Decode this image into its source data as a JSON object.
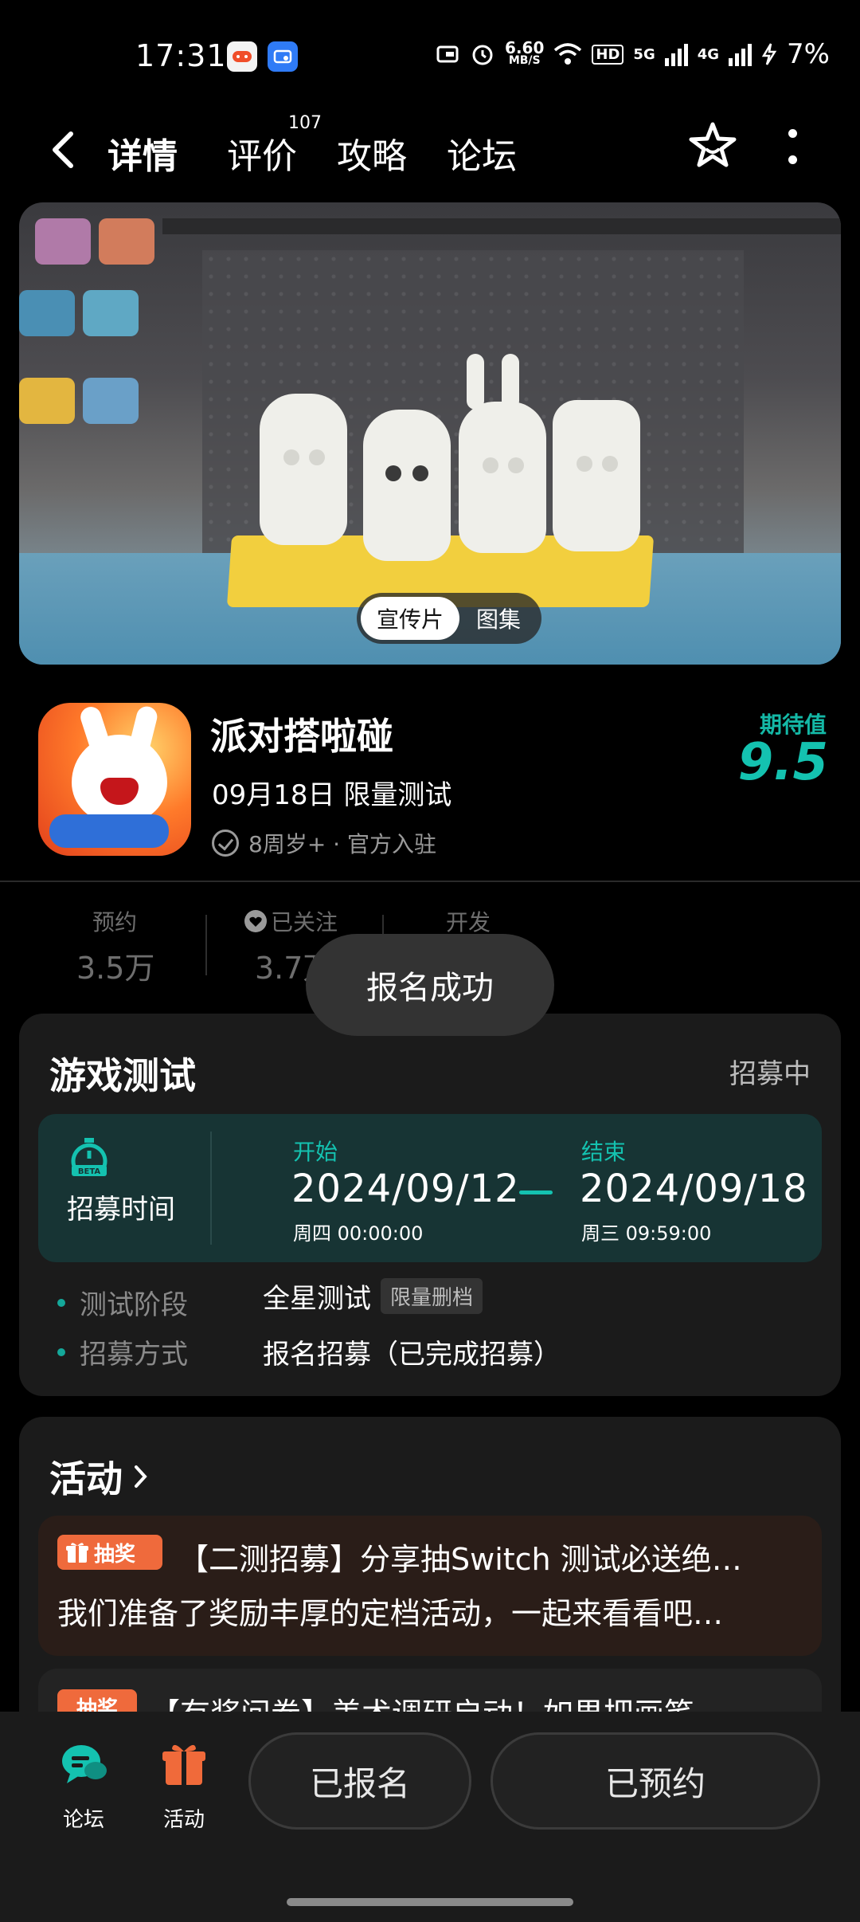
{
  "status_bar": {
    "time": "17:31",
    "net_speed": "6.60",
    "net_unit": "MB/S",
    "hd_tag": "HD",
    "sig1": "5G",
    "sig2": "4G",
    "battery": "7%"
  },
  "header": {
    "tabs": [
      {
        "label": "详情",
        "active": true
      },
      {
        "label": "评价",
        "badge": "107"
      },
      {
        "label": "攻略"
      },
      {
        "label": "论坛"
      }
    ]
  },
  "banner": {
    "toggle": {
      "active": "宣传片",
      "inactive": "图集"
    }
  },
  "game": {
    "title": "派对搭啦碰",
    "date_info": "09月18日 限量测试",
    "meta": "8周岁+ · 官方入驻",
    "expect_label": "期待值",
    "expect_value": "9.5"
  },
  "stats": [
    {
      "label": "预约",
      "value": "3.5万"
    },
    {
      "label": "已关注",
      "value": "3.7万"
    },
    {
      "label": "开发",
      "value": ""
    }
  ],
  "toast": "报名成功",
  "test_card": {
    "title": "游戏测试",
    "status": "招募中",
    "recruit_label": "招募时间",
    "start_label": "开始",
    "start_date": "2024/09/12",
    "start_sub": "周四  00:00:00",
    "end_label": "结束",
    "end_date": "2024/09/18",
    "end_sub": "周三  09:59:00",
    "rows": [
      {
        "label": "测试阶段",
        "value": "全星测试",
        "tag": "限量删档"
      },
      {
        "label": "招募方式",
        "value": "报名招募（已完成招募）"
      }
    ]
  },
  "activities": {
    "title": "活动",
    "items": [
      {
        "tag": "抽奖",
        "title": "【二测招募】分享抽Switch 测试必送绝…",
        "desc": "我们准备了奖励丰厚的定档活动，一起来看看吧…"
      },
      {
        "tag": "抽奖",
        "title": "【有奖问卷】美术调研启动！如果把画笔…"
      }
    ]
  },
  "bottom_bar": {
    "forum": "论坛",
    "activity": "活动",
    "signed": "已报名",
    "reserved": "已预约"
  },
  "colors": {
    "accent": "#14b8a6",
    "lottery": "#ef6a3c",
    "card": "#1b1b1b"
  }
}
